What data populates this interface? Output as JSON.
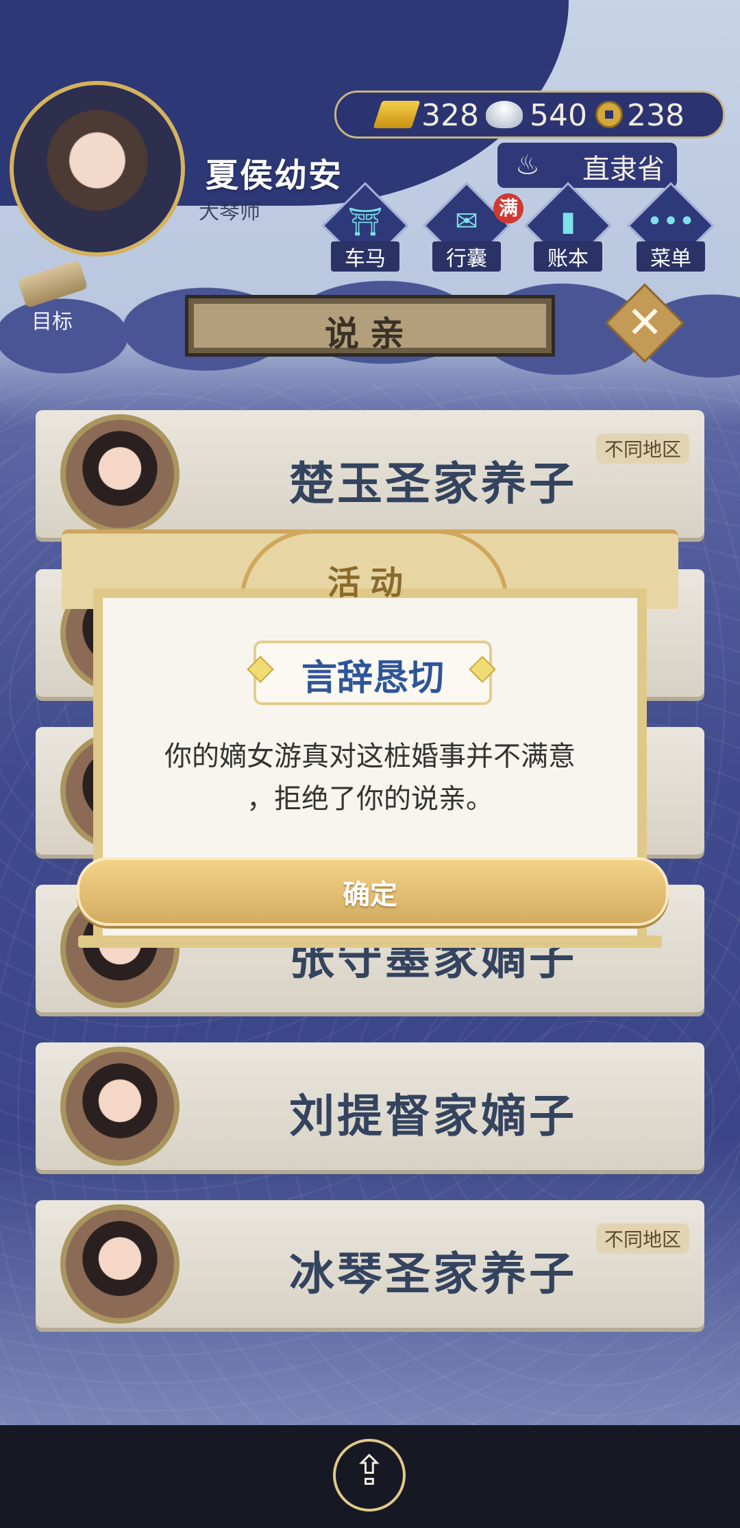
{
  "player": {
    "name": "夏侯幼安",
    "title": "大琴师",
    "province": "直隶省"
  },
  "currency": {
    "gold": "328",
    "silver": "540",
    "coin": "238"
  },
  "hud_buttons": [
    {
      "label": "车马",
      "icon": "carriage-icon"
    },
    {
      "label": "行囊",
      "icon": "bag-icon",
      "badge": "满"
    },
    {
      "label": "账本",
      "icon": "ledger-icon"
    },
    {
      "label": "菜单",
      "icon": "menu-icon"
    }
  ],
  "goal": {
    "label": "目标"
  },
  "screen_title": "说亲",
  "cards": [
    {
      "name": "楚玉圣家养子",
      "tag": "不同地区"
    },
    {
      "name": "",
      "tag": ""
    },
    {
      "name": "",
      "tag": ""
    },
    {
      "name": "张守墨家嫡子",
      "tag": ""
    },
    {
      "name": "刘提督家嫡子",
      "tag": ""
    },
    {
      "name": "冰琴圣家养子",
      "tag": "不同地区"
    }
  ],
  "dialog": {
    "header": "活动",
    "subtitle": "言辞恳切",
    "message_line1": "你的嫡女游真对这桩婚事并不满意",
    "message_line2": "，拒绝了你的说亲。",
    "confirm": "确定"
  },
  "colors": {
    "accent_gold": "#e0c988",
    "card_text": "#34445f",
    "dialog_title": "#2f5599"
  }
}
